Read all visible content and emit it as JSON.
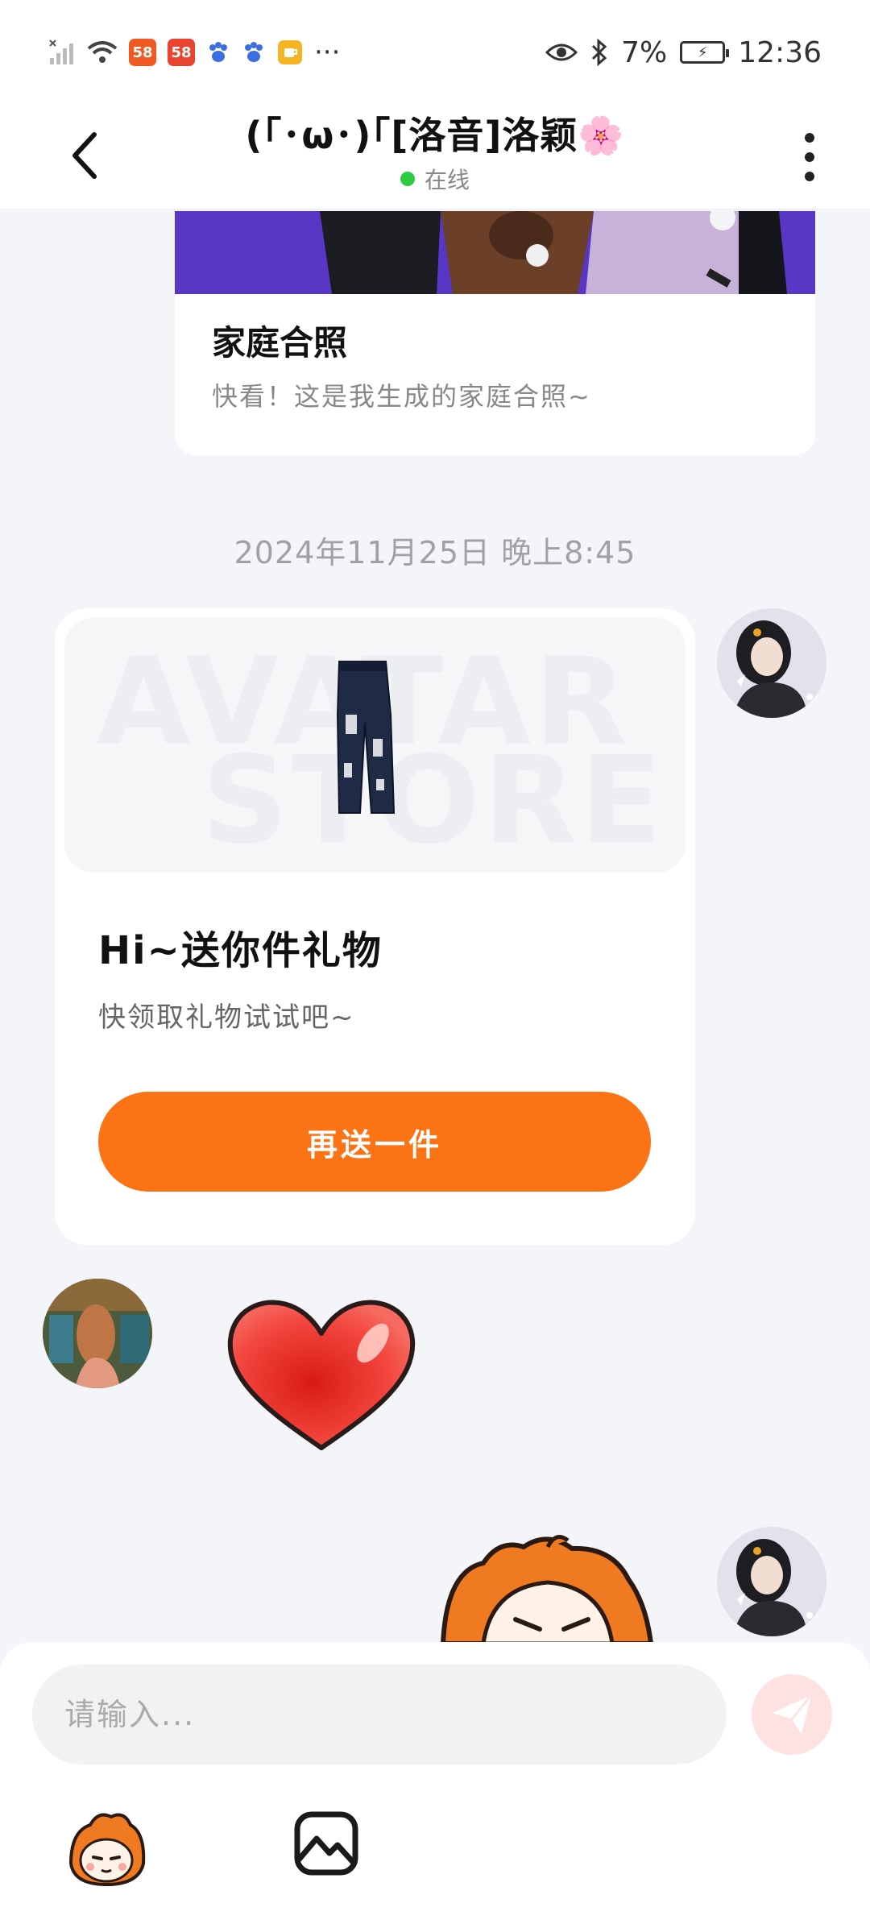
{
  "status_bar": {
    "app_badges": [
      "58",
      "58"
    ],
    "more": "···",
    "battery": "7%",
    "time": "12:36"
  },
  "header": {
    "title": "(｢･ω･)｢[洛音]洛颖🌸",
    "status": "在线"
  },
  "photo_card": {
    "title": "家庭合照",
    "subtitle": "快看！这是我生成的家庭合照~"
  },
  "timestamp": "2024年11月25日 晚上8:45",
  "gift_card": {
    "watermark_top": "AVATAR",
    "watermark_bottom": "STORE",
    "title": "Hi~送你件礼物",
    "subtitle": "快领取礼物试试吧~",
    "button": "再送一件"
  },
  "composer": {
    "placeholder": "请输入..."
  },
  "colors": {
    "accent": "#fb7314",
    "online": "#2ecc40",
    "send_disabled": "#fde2e1"
  }
}
